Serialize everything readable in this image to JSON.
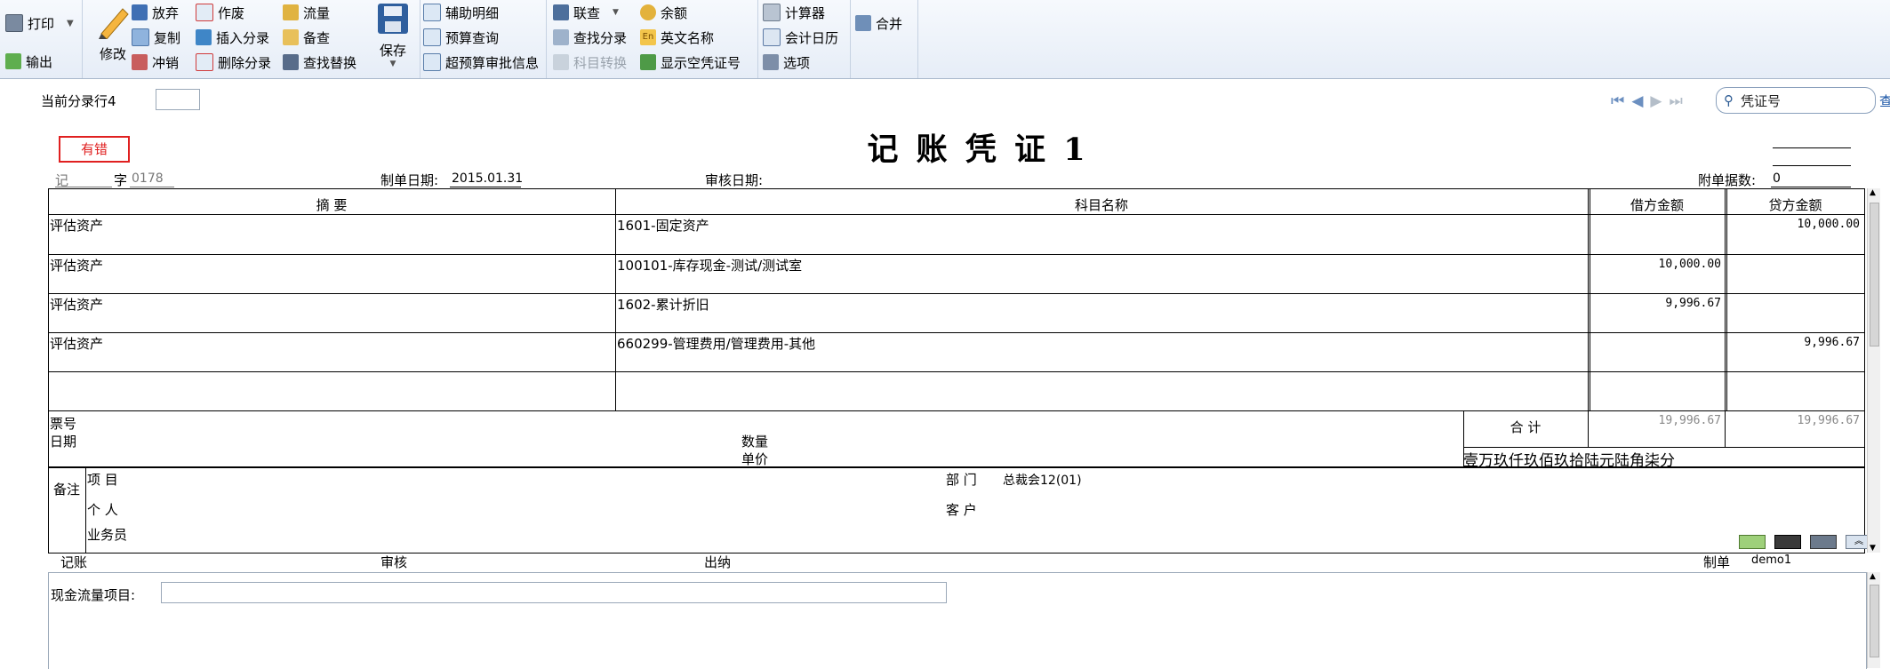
{
  "toolbar": {
    "print": "打印",
    "export": "输出",
    "edit": "修改",
    "abandon": "放弃",
    "copy": "复制",
    "reverse": "冲销",
    "void": "作废",
    "insert_entry": "插入分录",
    "delete_entry": "删除分录",
    "flow": "流量",
    "check": "备查",
    "find_replace": "查找替换",
    "save": "保存",
    "aux_detail": "辅助明细",
    "budget_query": "预算查询",
    "over_budget": "超预算审批信息",
    "link_query": "联查",
    "find_entry": "查找分录",
    "subject_convert": "科目转换",
    "balance": "余额",
    "english_name": "英文名称",
    "show_void_no": "显示空凭证号",
    "calculator": "计算器",
    "calendar": "会计日历",
    "options": "选项",
    "merge": "合并"
  },
  "nav": {
    "current_row_label": "当前分录行4",
    "current_row_value": "",
    "search_placeholder": "凭证号",
    "search_button": "查"
  },
  "voucher": {
    "title": "记 账 凭 证 1",
    "error_badge": "有错",
    "type": "记",
    "zi": "字",
    "number": "0178",
    "date_label": "制单日期:",
    "date": "2015.01.31",
    "audit_date_label": "审核日期:",
    "attachments_label": "附单据数:",
    "attachments": "0"
  },
  "table": {
    "headers": {
      "summary": "摘  要",
      "account": "科目名称",
      "debit": "借方金额",
      "credit": "贷方金额"
    },
    "rows": [
      {
        "summary": "评估资产",
        "account": "1601-固定资产",
        "debit": "",
        "credit": "10,000.00"
      },
      {
        "summary": "评估资产",
        "account": "100101-库存现金-测试/测试室",
        "debit": "10,000.00",
        "credit": ""
      },
      {
        "summary": "评估资产",
        "account": "1602-累计折旧",
        "debit": "9,996.67",
        "credit": ""
      },
      {
        "summary": "评估资产",
        "account": "660299-管理费用/管理费用-其他",
        "debit": "",
        "credit": "9,996.67"
      },
      {
        "summary": "",
        "account": "",
        "debit": "",
        "credit": ""
      }
    ],
    "ticket_no_label": "票号",
    "date_label": "日期",
    "qty_label": "数量",
    "price_label": "单价",
    "total_label": "合  计",
    "total_debit": "19,996.67",
    "total_credit": "19,996.67",
    "amount_in_words": "壹万玖仟玖佰玖拾陆元陆角柒分"
  },
  "remarks": {
    "label": "备注",
    "project": "项  目",
    "department_label": "部  门",
    "department_value": "总裁会12(01)",
    "person": "个  人",
    "customer": "客  户",
    "salesman": "业务员"
  },
  "signatures": {
    "bookkeeper": "记账",
    "auditor": "审核",
    "cashier": "出纳",
    "maker_label": "制单",
    "maker": "demo1"
  },
  "cashflow": {
    "label": "现金流量项目:",
    "value": ""
  }
}
